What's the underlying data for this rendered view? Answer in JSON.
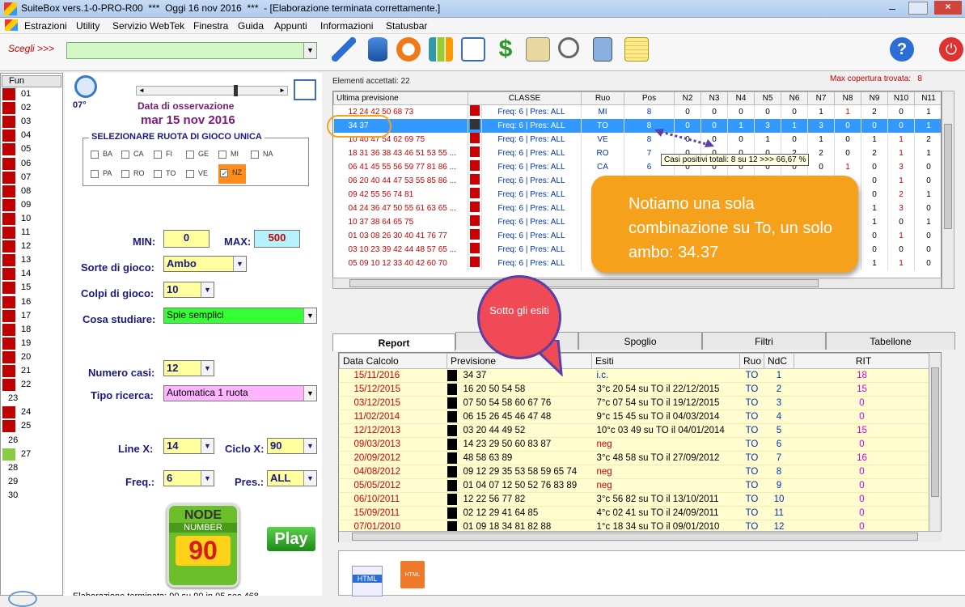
{
  "title": "SuiteBox vers.1-0-PRO-R00  ***  Oggi 16 nov 2016  ***  - [Elaborazione terminata correttamente.]",
  "menu": [
    "Estrazioni",
    "Utility",
    "Servizio WebTek",
    "Finestra",
    "Guida",
    "Appunti",
    "Informazioni",
    "Statusbar"
  ],
  "scegli_label": "Scegli >>>",
  "toolbar_icons": [
    "pencil-icon",
    "database-icon",
    "clock-icon",
    "chart-icon",
    "calendar-grid-icon",
    "dollar-icon",
    "map-icon",
    "magnifier-icon",
    "calculator-icon",
    "notes-icon",
    "help-icon",
    "power-icon"
  ],
  "fun": {
    "header": "Fun",
    "rows": [
      {
        "n": "01",
        "c": "#c00000"
      },
      {
        "n": "02",
        "c": "#c00000"
      },
      {
        "n": "03",
        "c": "#c00000"
      },
      {
        "n": "04",
        "c": "#c00000"
      },
      {
        "n": "05",
        "c": "#c00000"
      },
      {
        "n": "06",
        "c": "#c00000"
      },
      {
        "n": "07",
        "c": "#c00000"
      },
      {
        "n": "08",
        "c": "#c00000"
      },
      {
        "n": "09",
        "c": "#c00000"
      },
      {
        "n": "10",
        "c": "#c00000"
      },
      {
        "n": "11",
        "c": "#c00000"
      },
      {
        "n": "12",
        "c": "#c00000"
      },
      {
        "n": "13",
        "c": "#c00000"
      },
      {
        "n": "14",
        "c": "#c00000"
      },
      {
        "n": "15",
        "c": "#c00000"
      },
      {
        "n": "16",
        "c": "#c00000"
      },
      {
        "n": "17",
        "c": "#c00000"
      },
      {
        "n": "18",
        "c": "#c00000"
      },
      {
        "n": "19",
        "c": "#c00000"
      },
      {
        "n": "20",
        "c": "#c00000"
      },
      {
        "n": "21",
        "c": "#c00000"
      },
      {
        "n": "22",
        "c": "#c00000"
      },
      {
        "n": "23",
        "c": ""
      },
      {
        "n": "24",
        "c": "#c00000"
      },
      {
        "n": "25",
        "c": "#c00000"
      },
      {
        "n": "26",
        "c": ""
      },
      {
        "n": "27",
        "c": "#88cc44"
      },
      {
        "n": "28",
        "c": ""
      },
      {
        "n": "29",
        "c": ""
      },
      {
        "n": "30",
        "c": ""
      }
    ]
  },
  "obs": {
    "deg": "07°",
    "label": "Data di osservazione",
    "date": "mar 15 nov 2016"
  },
  "ruota": {
    "title": "SELEZIONARE RUOTA DI GIOCO UNICA",
    "row1": [
      "BA",
      "CA",
      "FI",
      "GE",
      "MI",
      "NA"
    ],
    "row2": [
      "PA",
      "RO",
      "TO",
      "VE"
    ],
    "checked": "NZ"
  },
  "min_label": "MIN:",
  "min": "0",
  "max_label": "MAX:",
  "max": "500",
  "sorte_label": "Sorte di gioco:",
  "sorte": "Ambo",
  "colpi_label": "Colpi di gioco:",
  "colpi": "10",
  "cosa_label": "Cosa studiare:",
  "cosa": "Spie semplici",
  "casi_label": "Numero casi:",
  "casi": "12",
  "tipo_label": "Tipo ricerca:",
  "tipo": "Automatica 1 ruota",
  "linex_label": "Line X:",
  "linex": "14",
  "ciclox_label": "Ciclo X:",
  "ciclox": "90",
  "freq_label": "Freq.:",
  "freq": "6",
  "pres_label": "Pres.:",
  "pres": "ALL",
  "logo": {
    "l1": "NODE",
    "l2": "NUMBER",
    "l3": "90"
  },
  "play": "Play",
  "status_bottom": "Elaborazione terminata: 90 su 90 in 05 sec 468",
  "accettati": "Elementi accettati: 22",
  "maxcop": "Max copertura trovata:   8",
  "g1_headers": [
    "Ultima previsione",
    "CLASSE",
    "Ruo",
    "Pos",
    "N2",
    "N3",
    "N4",
    "N5",
    "N6",
    "N7",
    "N8",
    "N9",
    "N10",
    "N11"
  ],
  "g1_rows": [
    [
      "12 24 42 50 68 73",
      "Freq: 6 | Pres: ALL",
      "MI",
      "8",
      "0",
      "0",
      "0",
      "0",
      "0",
      "1",
      "1",
      "2",
      "0",
      "1"
    ],
    [
      "34 37",
      "Freq: 6 | Pres: ALL",
      "TO",
      "8",
      "0",
      "0",
      "1",
      "3",
      "1",
      "3",
      "0",
      "0",
      "0",
      "1"
    ],
    [
      "10 40 47 54 62 69 75",
      "Freq: 6 | Pres: ALL",
      "VE",
      "8",
      "0",
      "0",
      "0",
      "1",
      "0",
      "1",
      "0",
      "1",
      "1",
      "2"
    ],
    [
      "18 31 36 38 43 46 51 53 55 ...",
      "Freq: 6 | Pres: ALL",
      "RO",
      "7",
      "0",
      "0",
      "0",
      "0",
      "2",
      "2",
      "0",
      "2",
      "1",
      "1"
    ],
    [
      "06 41 45 55 56 59 77 81 86 ...",
      "Freq: 6 | Pres: ALL",
      "CA",
      "6",
      "0",
      "0",
      "0",
      "0",
      "0",
      "0",
      "1",
      "0",
      "3",
      "0"
    ],
    [
      "06 20 40 44 47 53 55 85 86 ...",
      "Freq: 6 | Pres: ALL",
      "",
      "",
      "",
      "",
      "",
      "",
      "",
      "",
      "",
      "0",
      "1",
      "0"
    ],
    [
      "09 42 55 56 74 81",
      "Freq: 6 | Pres: ALL",
      "",
      "",
      "",
      "",
      "",
      "",
      "",
      "",
      "",
      "0",
      "2",
      "1"
    ],
    [
      "04 24 36 47 50 55 61 63 65 ...",
      "Freq: 6 | Pres: ALL",
      "",
      "",
      "",
      "",
      "",
      "",
      "",
      "",
      "",
      "1",
      "3",
      "0"
    ],
    [
      "10 37 38 64 65 75",
      "Freq: 6 | Pres: ALL",
      "",
      "",
      "",
      "",
      "",
      "",
      "",
      "",
      "",
      "1",
      "0",
      "1"
    ],
    [
      "01 03 08 26 30 40 41 76 77",
      "Freq: 6 | Pres: ALL",
      "",
      "",
      "",
      "",
      "",
      "",
      "",
      "",
      "",
      "0",
      "1",
      "0"
    ],
    [
      "03 10 23 39 42 44 48 57 65 ...",
      "Freq: 6 | Pres: ALL",
      "",
      "",
      "",
      "",
      "",
      "",
      "",
      "",
      "",
      "0",
      "0",
      "0"
    ],
    [
      "05 09 10 12 33 40 42 60 70",
      "Freq: 6 | Pres: ALL",
      "",
      "",
      "",
      "",
      "",
      "",
      "",
      "",
      "",
      "1",
      "1",
      "0"
    ]
  ],
  "tooltip": "Casi positivi totali: 8 su 12 >>> 66,67 %",
  "callout": "Notiamo una sola combinazione su To, un solo ambo: 34.37",
  "bubble": "Sotto gli esiti",
  "tabs": [
    "Report",
    "",
    "Spoglio",
    "Filtri",
    "Tabellone"
  ],
  "g2_headers": [
    "Data Calcolo",
    "Previsione",
    "Esiti",
    "Ruo",
    "NdC",
    "RIT"
  ],
  "g2_rows": [
    [
      "15/11/2016",
      "34 37",
      "i.c.",
      "TO",
      "1",
      "18"
    ],
    [
      "15/12/2015",
      "16 20 50 54 58",
      "3°c 20 54 su TO il 22/12/2015",
      "TO",
      "2",
      "15"
    ],
    [
      "03/12/2015",
      "07 50 54 58 60 67 76",
      "7°c 07 54 su TO il 19/12/2015",
      "TO",
      "3",
      "0"
    ],
    [
      "11/02/2014",
      "06 15 26 45 46 47 48",
      "9°c 15 45 su TO il 04/03/2014",
      "TO",
      "4",
      "0"
    ],
    [
      "12/12/2013",
      "03 20 44 49 52",
      "10°c 03 49 su TO il 04/01/2014",
      "TO",
      "5",
      "15"
    ],
    [
      "09/03/2013",
      "14 23 29 50 60 83 87",
      "neg",
      "TO",
      "6",
      "0"
    ],
    [
      "20/09/2012",
      "48 58 63 89",
      "3°c 48 58 su TO il 27/09/2012",
      "TO",
      "7",
      "16"
    ],
    [
      "04/08/2012",
      "09 12 29 35 53 58 59 65 74",
      "neg",
      "TO",
      "8",
      "0"
    ],
    [
      "05/05/2012",
      "01 04 07 12 50 52 76 83 89",
      "neg",
      "TO",
      "9",
      "0"
    ],
    [
      "06/10/2011",
      "12 22 56 77 82",
      "3°c 56 82 su TO il 13/10/2011",
      "TO",
      "10",
      "0"
    ],
    [
      "15/09/2011",
      "02 12 29 41 64 85",
      "4°c 02 41 su TO il 24/09/2011",
      "TO",
      "11",
      "0"
    ],
    [
      "07/01/2010",
      "01 09 18 34 81 82 88",
      "1°c 18 34 su TO il 09/01/2010",
      "TO",
      "12",
      "0"
    ]
  ],
  "bottom_icons": [
    "html-check-icon",
    "html-file-icon"
  ]
}
